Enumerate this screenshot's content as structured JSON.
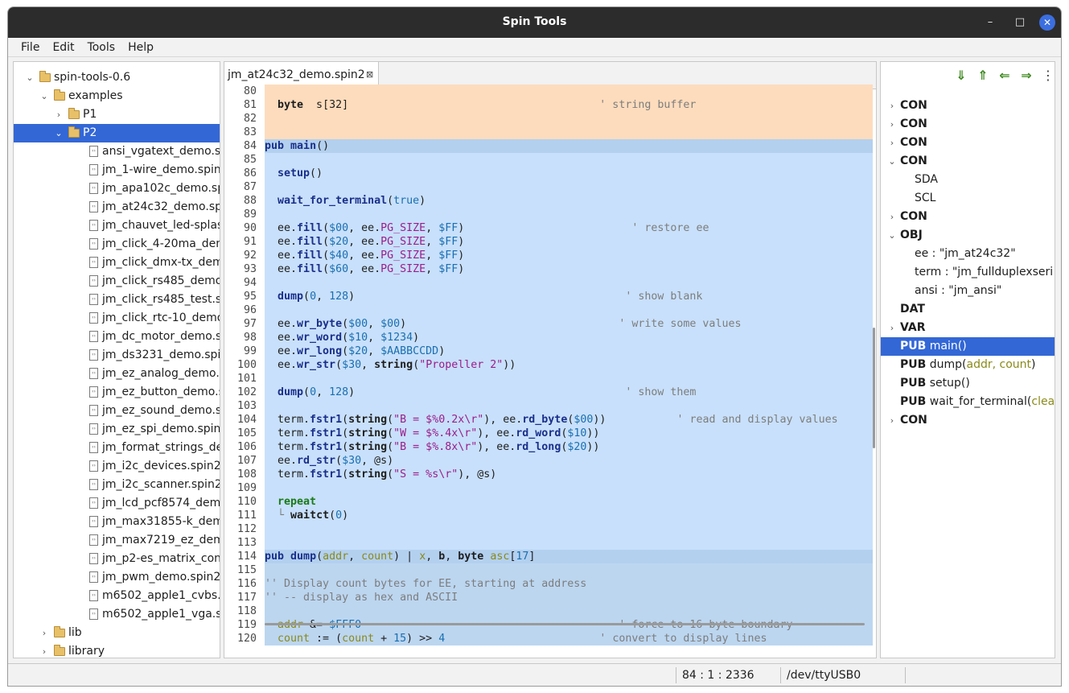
{
  "window": {
    "title": "Spin Tools",
    "minimize_glyph": "–",
    "maximize_glyph": "□",
    "close_glyph": "✕"
  },
  "menu": [
    "File",
    "Edit",
    "Tools",
    "Help"
  ],
  "tree": [
    {
      "label": "spin-tools-0.6",
      "type": "folder",
      "depth": 1,
      "expanded": true
    },
    {
      "label": "examples",
      "type": "folder",
      "depth": 2,
      "expanded": true
    },
    {
      "label": "P1",
      "type": "folder",
      "depth": 3,
      "expanded": false
    },
    {
      "label": "P2",
      "type": "folder",
      "depth": 3,
      "expanded": true,
      "selected": true
    },
    {
      "label": "ansi_vgatext_demo.sp",
      "type": "file",
      "depth": 4
    },
    {
      "label": "jm_1-wire_demo.spin2",
      "type": "file",
      "depth": 4
    },
    {
      "label": "jm_apa102c_demo.sp",
      "type": "file",
      "depth": 4
    },
    {
      "label": "jm_at24c32_demo.spi",
      "type": "file",
      "depth": 4
    },
    {
      "label": "jm_chauvet_led-splash",
      "type": "file",
      "depth": 4
    },
    {
      "label": "jm_click_4-20ma_dem",
      "type": "file",
      "depth": 4
    },
    {
      "label": "jm_click_dmx-tx_demo",
      "type": "file",
      "depth": 4
    },
    {
      "label": "jm_click_rs485_demo.",
      "type": "file",
      "depth": 4
    },
    {
      "label": "jm_click_rs485_test.sp",
      "type": "file",
      "depth": 4
    },
    {
      "label": "jm_click_rtc-10_demo.",
      "type": "file",
      "depth": 4
    },
    {
      "label": "jm_dc_motor_demo.s",
      "type": "file",
      "depth": 4
    },
    {
      "label": "jm_ds3231_demo.spin",
      "type": "file",
      "depth": 4
    },
    {
      "label": "jm_ez_analog_demo.s",
      "type": "file",
      "depth": 4
    },
    {
      "label": "jm_ez_button_demo.s",
      "type": "file",
      "depth": 4
    },
    {
      "label": "jm_ez_sound_demo.sp",
      "type": "file",
      "depth": 4
    },
    {
      "label": "jm_ez_spi_demo.spin2",
      "type": "file",
      "depth": 4
    },
    {
      "label": "jm_format_strings_de",
      "type": "file",
      "depth": 4
    },
    {
      "label": "jm_i2c_devices.spin2",
      "type": "file",
      "depth": 4
    },
    {
      "label": "jm_i2c_scanner.spin2",
      "type": "file",
      "depth": 4
    },
    {
      "label": "jm_lcd_pcf8574_demo",
      "type": "file",
      "depth": 4
    },
    {
      "label": "jm_max31855-k_demo",
      "type": "file",
      "depth": 4
    },
    {
      "label": "jm_max7219_ez_demo",
      "type": "file",
      "depth": 4
    },
    {
      "label": "jm_p2-es_matrix_cont",
      "type": "file",
      "depth": 4
    },
    {
      "label": "jm_pwm_demo.spin2",
      "type": "file",
      "depth": 4
    },
    {
      "label": "m6502_apple1_cvbs.s",
      "type": "file",
      "depth": 4
    },
    {
      "label": "m6502_apple1_vga.sp",
      "type": "file",
      "depth": 4
    },
    {
      "label": "lib",
      "type": "folder",
      "depth": 2,
      "expanded": false
    },
    {
      "label": "library",
      "type": "folder",
      "depth": 2,
      "expanded": false
    }
  ],
  "editor": {
    "tab_label": "jm_at24c32_demo.spin2",
    "tab_close_glyph": "⊠",
    "lines": [
      {
        "n": "80",
        "bg": "con",
        "html": ""
      },
      {
        "n": "81",
        "bg": "con",
        "html": "  <span class='k'>byte</span>  s[32]                                       <span class='cmt'>' string buffer</span>"
      },
      {
        "n": "82",
        "bg": "con",
        "html": ""
      },
      {
        "n": "83",
        "bg": "con",
        "html": ""
      },
      {
        "n": "84",
        "bg": "pubhead",
        "html": "<span class='b'>pub</span> <span class='f'>main</span>()"
      },
      {
        "n": "85",
        "bg": "pub",
        "html": ""
      },
      {
        "n": "86",
        "bg": "pub",
        "html": "  <span class='f'>setup</span>()"
      },
      {
        "n": "87",
        "bg": "pub",
        "html": ""
      },
      {
        "n": "88",
        "bg": "pub",
        "html": "  <span class='f'>wait_for_terminal</span>(<span class='num'>true</span>)"
      },
      {
        "n": "89",
        "bg": "pub",
        "html": ""
      },
      {
        "n": "90",
        "bg": "pub",
        "html": "  ee.<span class='f'>fill</span>(<span class='num'>$00</span>, ee.<span class='con'>PG_SIZE</span>, <span class='num'>$FF</span>)                          <span class='cmt'>' restore ee</span>"
      },
      {
        "n": "91",
        "bg": "pub",
        "html": "  ee.<span class='f'>fill</span>(<span class='num'>$20</span>, ee.<span class='con'>PG_SIZE</span>, <span class='num'>$FF</span>)"
      },
      {
        "n": "92",
        "bg": "pub",
        "html": "  ee.<span class='f'>fill</span>(<span class='num'>$40</span>, ee.<span class='con'>PG_SIZE</span>, <span class='num'>$FF</span>)"
      },
      {
        "n": "93",
        "bg": "pub",
        "html": "  ee.<span class='f'>fill</span>(<span class='num'>$60</span>, ee.<span class='con'>PG_SIZE</span>, <span class='num'>$FF</span>)"
      },
      {
        "n": "94",
        "bg": "pub",
        "html": ""
      },
      {
        "n": "95",
        "bg": "pub",
        "html": "  <span class='f'>dump</span>(<span class='num'>0</span>, <span class='num'>128</span>)                                          <span class='cmt'>' show blank</span>"
      },
      {
        "n": "96",
        "bg": "pub",
        "html": ""
      },
      {
        "n": "97",
        "bg": "pub",
        "html": "  ee.<span class='f'>wr_byte</span>(<span class='num'>$00</span>, <span class='num'>$00</span>)                                 <span class='cmt'>' write some values</span>"
      },
      {
        "n": "98",
        "bg": "pub",
        "html": "  ee.<span class='f'>wr_word</span>(<span class='num'>$10</span>, <span class='num'>$1234</span>)"
      },
      {
        "n": "99",
        "bg": "pub",
        "html": "  ee.<span class='f'>wr_long</span>(<span class='num'>$20</span>, <span class='num'>$AABBCCDD</span>)"
      },
      {
        "n": "100",
        "bg": "pub",
        "html": "  ee.<span class='f'>wr_str</span>(<span class='num'>$30</span>, <span class='k'>string</span>(<span class='str'>\"Propeller 2\"</span>))"
      },
      {
        "n": "101",
        "bg": "pub",
        "html": ""
      },
      {
        "n": "102",
        "bg": "pub",
        "html": "  <span class='f'>dump</span>(<span class='num'>0</span>, <span class='num'>128</span>)                                          <span class='cmt'>' show them</span>"
      },
      {
        "n": "103",
        "bg": "pub",
        "html": ""
      },
      {
        "n": "104",
        "bg": "pub",
        "html": "  term.<span class='f'>fstr1</span>(<span class='k'>string</span>(<span class='str'>\"B = $%0.2x\\r\"</span>), ee.<span class='f'>rd_byte</span>(<span class='num'>$00</span>))           <span class='cmt'>' read and display values</span>"
      },
      {
        "n": "105",
        "bg": "pub",
        "html": "  term.<span class='f'>fstr1</span>(<span class='k'>string</span>(<span class='str'>\"W = $%.4x\\r\"</span>), ee.<span class='f'>rd_word</span>(<span class='num'>$10</span>))"
      },
      {
        "n": "106",
        "bg": "pub",
        "html": "  term.<span class='f'>fstr1</span>(<span class='k'>string</span>(<span class='str'>\"B = $%.8x\\r\"</span>), ee.<span class='f'>rd_long</span>(<span class='num'>$20</span>))"
      },
      {
        "n": "107",
        "bg": "pub",
        "html": "  ee.<span class='f'>rd_str</span>(<span class='num'>$30</span>, @s)"
      },
      {
        "n": "108",
        "bg": "pub",
        "html": "  term.<span class='f'>fstr1</span>(<span class='k'>string</span>(<span class='str'>\"S = %s\\r\"</span>), @s)"
      },
      {
        "n": "109",
        "bg": "pub",
        "html": ""
      },
      {
        "n": "110",
        "bg": "pub",
        "html": "  <span class='kw2'>repeat</span>"
      },
      {
        "n": "111",
        "bg": "pub",
        "html": "  <span class='cmt'>└</span> <span class='k'>waitct</span>(<span class='num'>0</span>)"
      },
      {
        "n": "112",
        "bg": "pub",
        "html": ""
      },
      {
        "n": "113",
        "bg": "pub",
        "html": ""
      },
      {
        "n": "114",
        "bg": "pubhead",
        "html": "<span class='b'>pub</span> <span class='f'>dump</span>(<span class='par'>addr</span>, <span class='par'>count</span>) | <span class='par'>x</span>, <span class='k'>b</span>, <span class='k'>byte</span> <span class='par'>asc</span>[<span class='num'>17</span>]"
      },
      {
        "n": "115",
        "bg": "pub2",
        "html": ""
      },
      {
        "n": "116",
        "bg": "pub2",
        "html": "<span class='cmt'>'' Display count bytes for EE, starting at address</span>"
      },
      {
        "n": "117",
        "bg": "pub2",
        "html": "<span class='cmt'>'' -- display as hex and ASCII</span>"
      },
      {
        "n": "118",
        "bg": "pub2",
        "html": ""
      },
      {
        "n": "119",
        "bg": "pub2",
        "html": "  <span class='par'>addr</span> &amp;= <span class='num'>$FFF0</span>                                        <span class='cmt'>' force to 16-byte boundary</span>"
      },
      {
        "n": "120",
        "bg": "pub2",
        "html": "  <span class='par'>count</span> := (<span class='par'>count</span> + <span class='num'>15</span>) >> <span class='num'>4</span>                        <span class='cmt'>' convert to display lines</span>"
      }
    ]
  },
  "outline": {
    "tools": [
      {
        "name": "next-member-icon",
        "glyph": "⇓"
      },
      {
        "name": "previous-member-icon",
        "glyph": "⇑"
      },
      {
        "name": "back-icon",
        "glyph": "⇐"
      },
      {
        "name": "forward-icon",
        "glyph": "⇒"
      },
      {
        "name": "more-icon",
        "glyph": "⋮"
      }
    ],
    "items": [
      {
        "kw": "CON",
        "rest": "",
        "depth": 0,
        "arrow": "›"
      },
      {
        "kw": "CON",
        "rest": "",
        "depth": 0,
        "arrow": "›"
      },
      {
        "kw": "CON",
        "rest": "",
        "depth": 0,
        "arrow": "›"
      },
      {
        "kw": "CON",
        "rest": "",
        "depth": 0,
        "arrow": "⌄"
      },
      {
        "kw": "",
        "rest": "SDA",
        "depth": 1,
        "arrow": ""
      },
      {
        "kw": "",
        "rest": "SCL",
        "depth": 1,
        "arrow": ""
      },
      {
        "kw": "CON",
        "rest": "",
        "depth": 0,
        "arrow": "›"
      },
      {
        "kw": "OBJ",
        "rest": "",
        "depth": 0,
        "arrow": "⌄"
      },
      {
        "kw": "",
        "rest": "ee  : \"jm_at24c32\"",
        "depth": 1,
        "arrow": ""
      },
      {
        "kw": "",
        "rest": "term : \"jm_fullduplexseri",
        "depth": 1,
        "arrow": ""
      },
      {
        "kw": "",
        "rest": "ansi : \"jm_ansi\"",
        "depth": 1,
        "arrow": ""
      },
      {
        "kw": "DAT",
        "rest": "",
        "depth": 0,
        "arrow": ""
      },
      {
        "kw": "VAR",
        "rest": "",
        "depth": 0,
        "arrow": "›"
      },
      {
        "kw": "PUB",
        "rest": " main()",
        "depth": 0,
        "arrow": "",
        "selected": true
      },
      {
        "kw": "PUB",
        "rest": " dump(",
        "par": "addr, count",
        "tail": ")",
        "depth": 0,
        "arrow": ""
      },
      {
        "kw": "PUB",
        "rest": " setup()",
        "depth": 0,
        "arrow": ""
      },
      {
        "kw": "PUB",
        "rest": " wait_for_terminal(",
        "par": "clea",
        "tail": "",
        "depth": 0,
        "arrow": ""
      },
      {
        "kw": "CON",
        "rest": "",
        "depth": 0,
        "arrow": "›"
      }
    ]
  },
  "status": {
    "position": "84 : 1 : 2336",
    "port": "/dev/ttyUSB0"
  },
  "colors": {
    "selection": "#3367d6",
    "con_block": "#fddcbd",
    "pub_block": "#c8e0fb",
    "titlebar": "#2c2c2c"
  }
}
